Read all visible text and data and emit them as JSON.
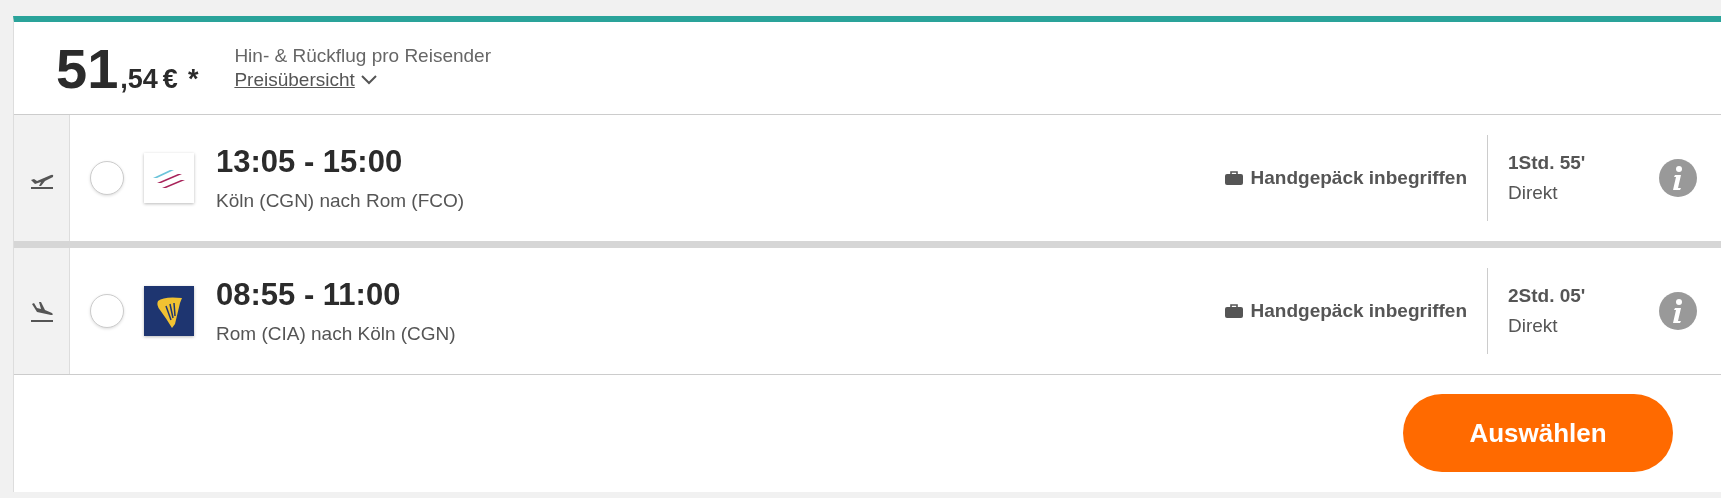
{
  "price": {
    "whole": "51",
    "decimals": ",54",
    "currency": "€",
    "asterisk": "*"
  },
  "price_note": "Hin- & Rückflug pro Reisender",
  "price_overview_link": "Preisübersicht",
  "flights": [
    {
      "kind": "outbound",
      "logo": {
        "kind": "stripes"
      },
      "selected": false,
      "times": "13:05 - 15:00",
      "route": "Köln (CGN) nach Rom (FCO)",
      "baggage": "Handgepäck inbegriffen",
      "duration": "1Std. 55'",
      "stops": "Direkt"
    },
    {
      "kind": "return",
      "logo": {
        "kind": "harp"
      },
      "selected": false,
      "times": "08:55 - 11:00",
      "route": "Rom (CIA) nach Köln (CGN)",
      "baggage": "Handgepäck inbegriffen",
      "duration": "2Std. 05'",
      "stops": "Direkt"
    }
  ],
  "select_button": "Auswählen"
}
